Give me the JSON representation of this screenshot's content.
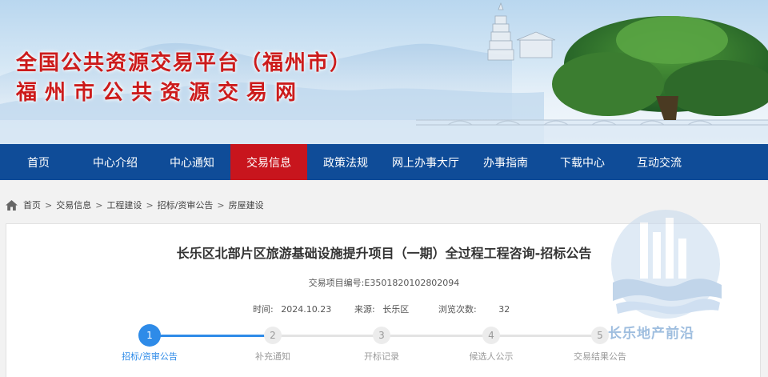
{
  "header": {
    "title": "全国公共资源交易平台（福州市）",
    "subtitle": "福州市公共资源交易网"
  },
  "nav": {
    "items": [
      {
        "label": "首页"
      },
      {
        "label": "中心介绍"
      },
      {
        "label": "中心通知"
      },
      {
        "label": "交易信息",
        "active": true
      },
      {
        "label": "政策法规"
      },
      {
        "label": "网上办事大厅"
      },
      {
        "label": "办事指南"
      },
      {
        "label": "下载中心"
      },
      {
        "label": "互动交流"
      }
    ]
  },
  "breadcrumb": {
    "icon": "home-icon",
    "separator": ">",
    "items": [
      "首页",
      "交易信息",
      "工程建设",
      "招标/资审公告",
      "房屋建设"
    ]
  },
  "article": {
    "title": "长乐区北部片区旅游基础设施提升项目（一期）全过程工程咨询-招标公告",
    "project_code": "交易项目编号:E3501820102802094",
    "time_label": "时间:",
    "time_value": "2024.10.23",
    "source_label": "来源:",
    "source_value": "长乐区",
    "views_label": "浏览次数:",
    "views_value": "32"
  },
  "progress": {
    "current_step": 1,
    "steps": [
      {
        "number": "1",
        "label": "招标/资审公告"
      },
      {
        "number": "2",
        "label": "补充通知"
      },
      {
        "number": "3",
        "label": "开标记录"
      },
      {
        "number": "4",
        "label": "候选人公示"
      },
      {
        "number": "5",
        "label": "交易结果公告"
      }
    ]
  },
  "watermark": {
    "text": "长乐地产前沿"
  },
  "colors": {
    "nav_bg": "#0f4c98",
    "nav_active": "#c8151d",
    "title_red": "#cc1b1b",
    "step_active": "#2e8be8"
  }
}
